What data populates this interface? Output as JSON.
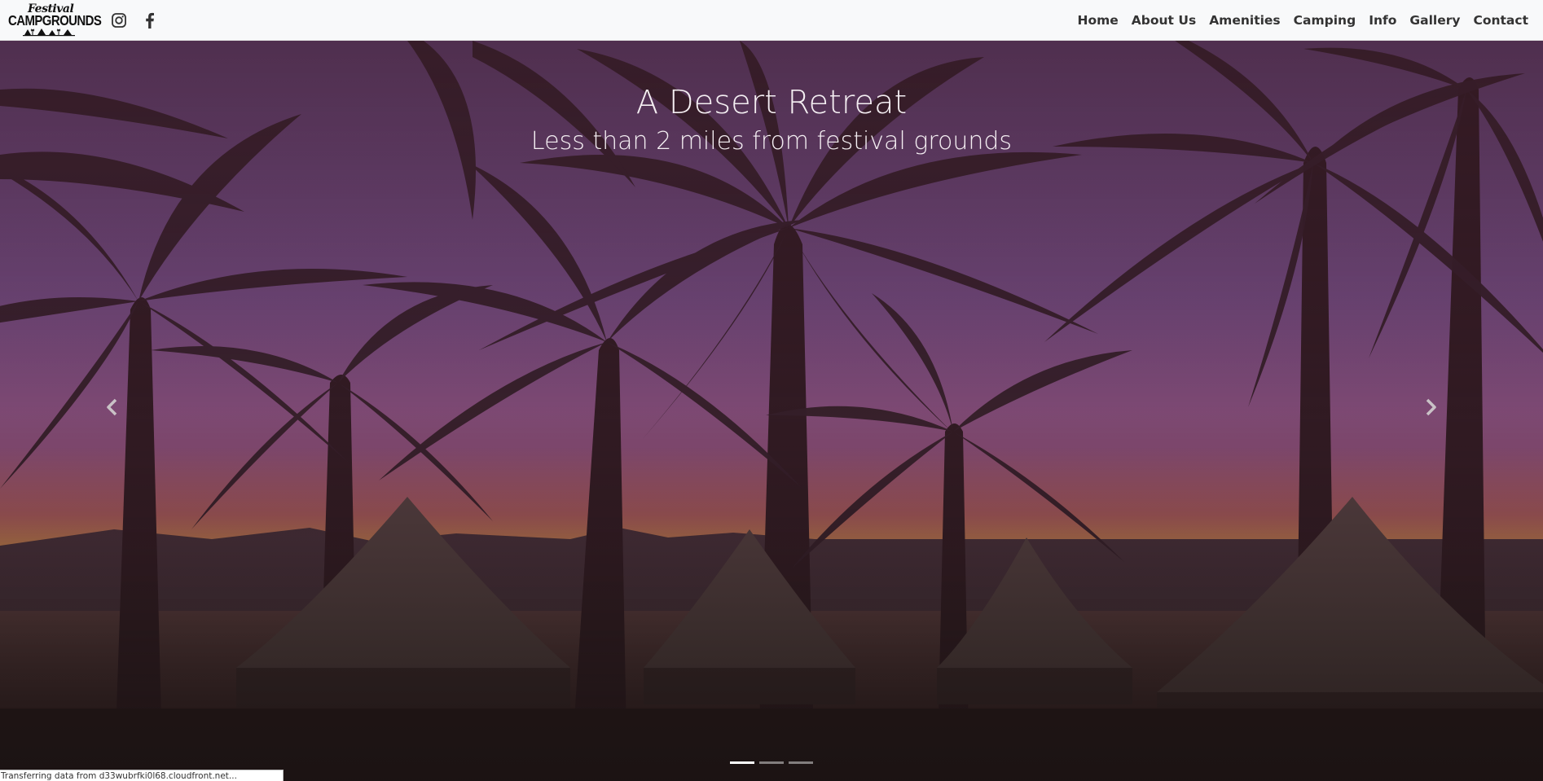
{
  "brand": {
    "script_text": "Festival",
    "block_text": "CAMPGROUNDS"
  },
  "social": [
    {
      "icon": "instagram-icon"
    },
    {
      "icon": "facebook-icon"
    }
  ],
  "nav": {
    "items": [
      "Home",
      "About Us",
      "Amenities",
      "Camping",
      "Info",
      "Gallery",
      "Contact"
    ]
  },
  "hero": {
    "title": "A Desert Retreat",
    "subtitle": "Less than 2 miles from festival grounds",
    "prev_icon": "chevron-left-icon",
    "next_icon": "chevron-right-icon",
    "slides_count": 3,
    "active_slide": 1
  },
  "status_bar": {
    "text": "Transferring data from d33wubrfki0l68.cloudfront.net..."
  },
  "colors": {
    "navbar_bg": "#f8f9fa",
    "nav_text": "#333333",
    "sky_top": "#6a4a86",
    "sky_sunset": "#f0a050",
    "overlay": "#3a1c28"
  }
}
